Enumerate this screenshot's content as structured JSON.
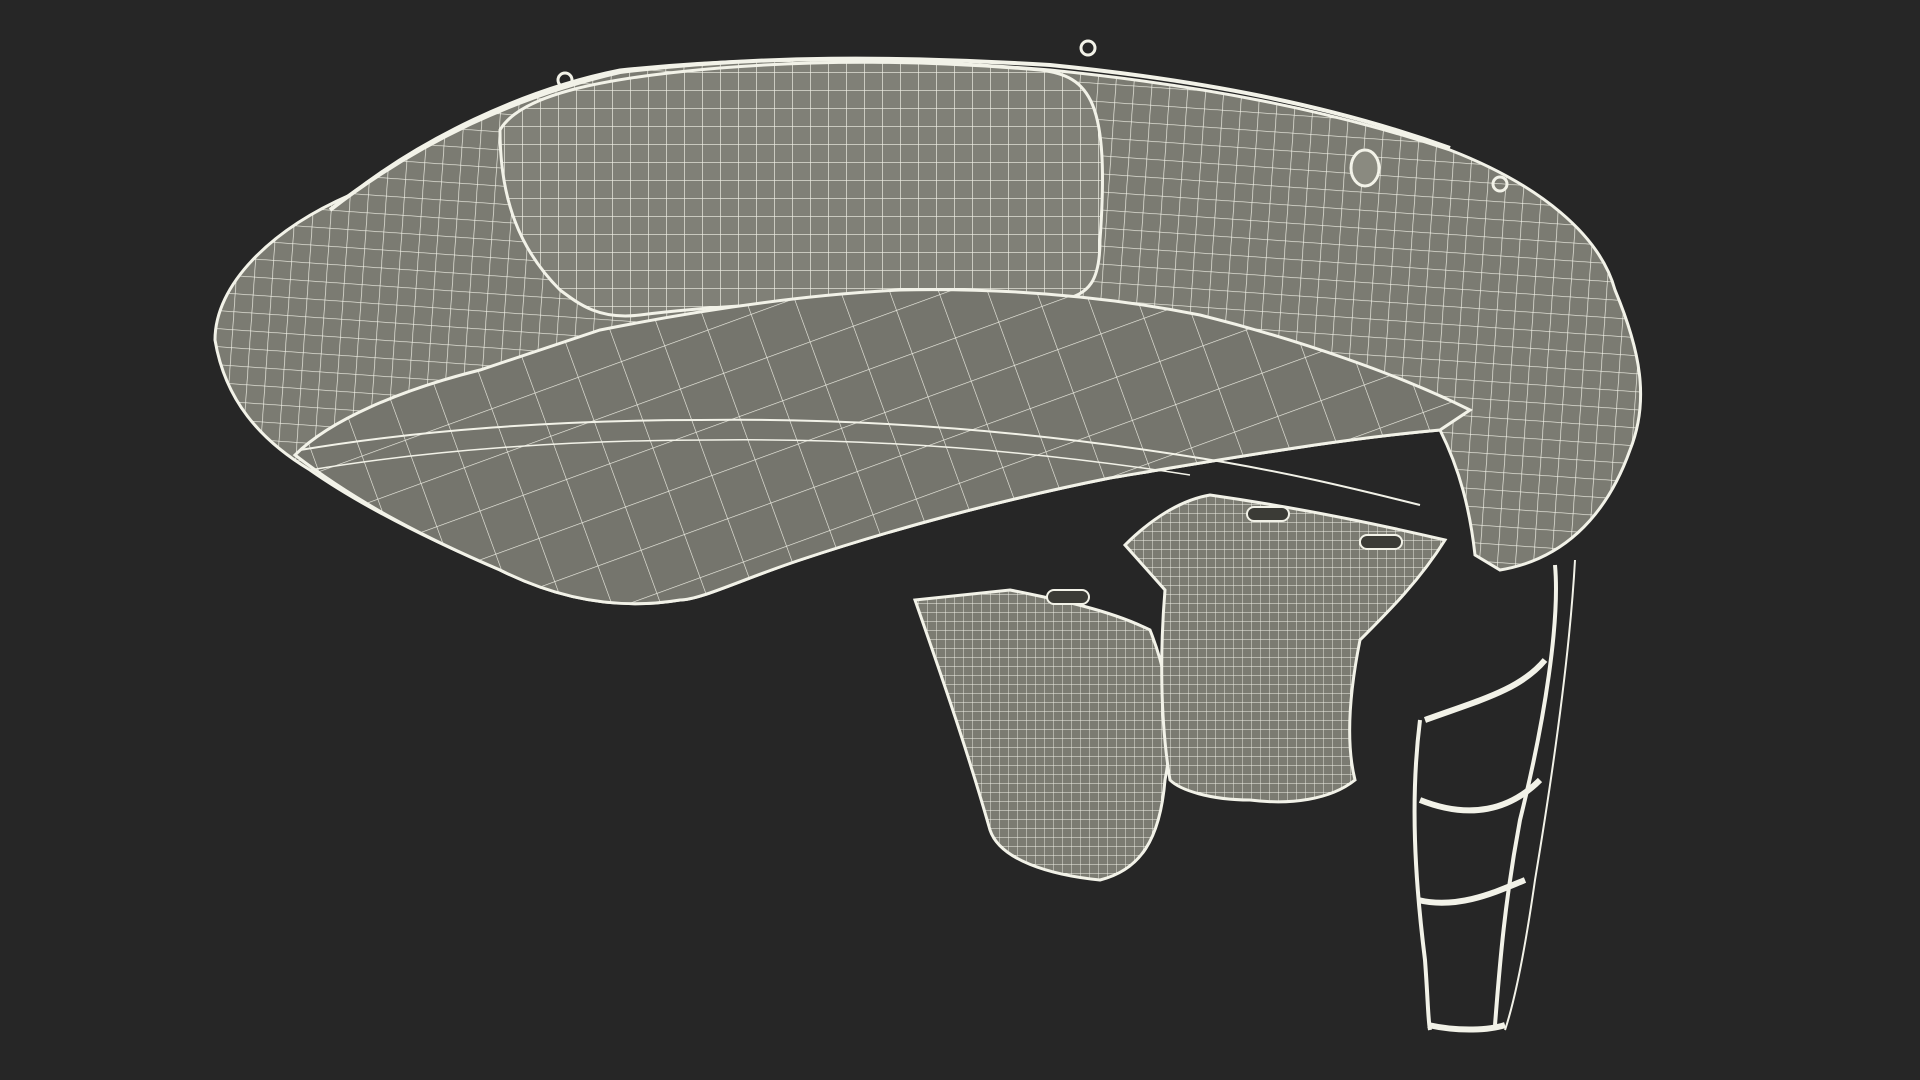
{
  "scene": {
    "subject": "inflatable-life-raft-wireframe",
    "colors": {
      "background": "#262626",
      "surface": "#7b7b72",
      "surface_dark": "#6a6a62",
      "surface_shadow": "#55554f",
      "wire": "#f2f2e8"
    },
    "parts": [
      "raft-tube",
      "raft-floor",
      "ballast-pocket",
      "ballast-pocket",
      "ballast-pocket",
      "ballast-pocket",
      "boarding-ladder"
    ]
  }
}
